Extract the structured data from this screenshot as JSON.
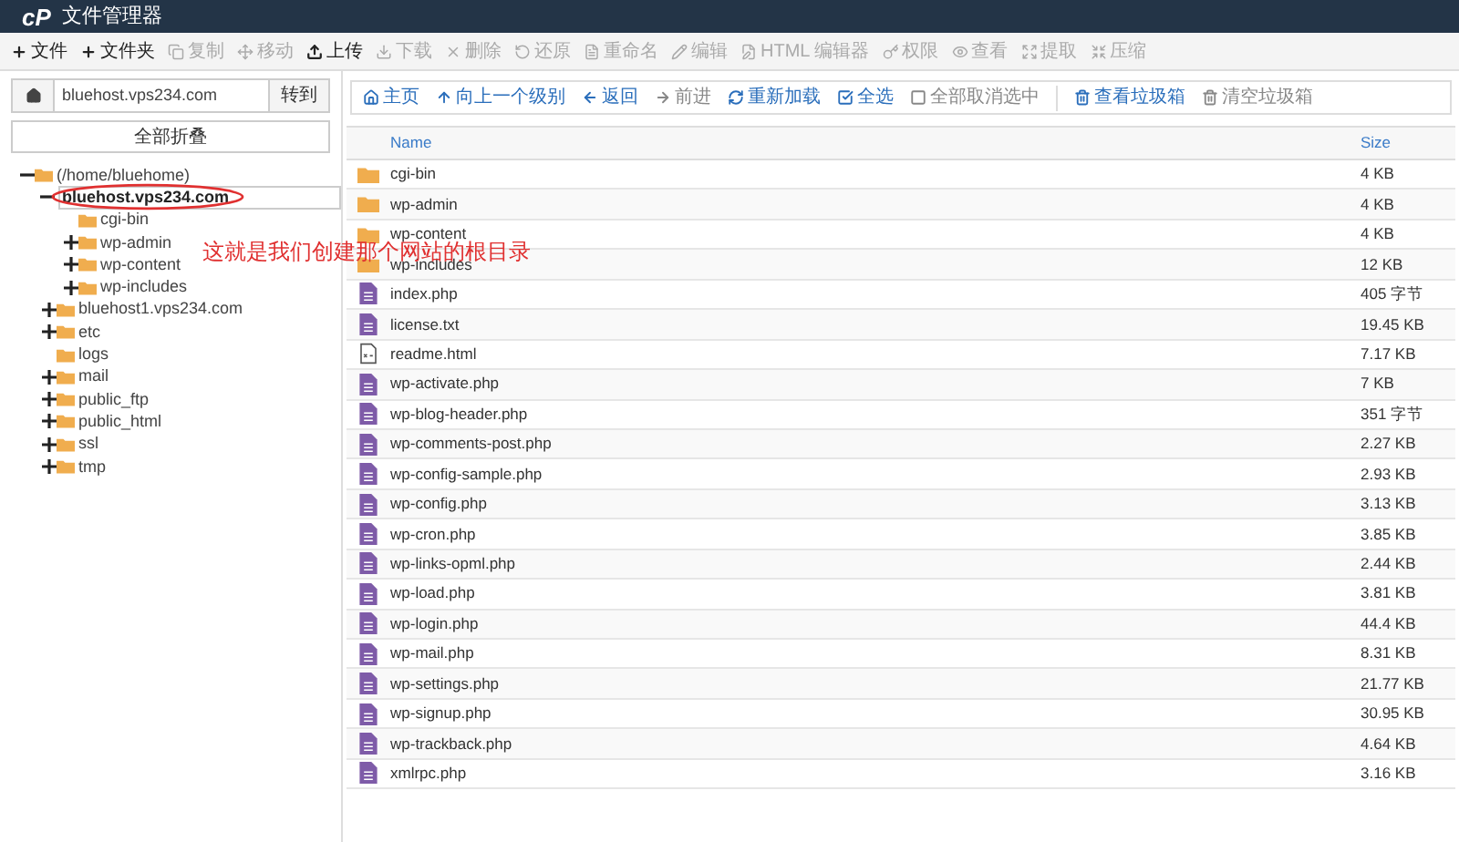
{
  "header": {
    "logo": "cP",
    "title": "文件管理器"
  },
  "toolbar": [
    {
      "label": "文件",
      "disabled": false
    },
    {
      "label": "文件夹",
      "disabled": false
    },
    {
      "label": "复制",
      "disabled": true
    },
    {
      "label": "移动",
      "disabled": true
    },
    {
      "label": "上传",
      "disabled": false
    },
    {
      "label": "下载",
      "disabled": true
    },
    {
      "label": "删除",
      "disabled": true
    },
    {
      "label": "还原",
      "disabled": true
    },
    {
      "label": "重命名",
      "disabled": true
    },
    {
      "label": "编辑",
      "disabled": true
    },
    {
      "label": "HTML 编辑器",
      "disabled": true
    },
    {
      "label": "权限",
      "disabled": true
    },
    {
      "label": "查看",
      "disabled": true
    },
    {
      "label": "提取",
      "disabled": true
    },
    {
      "label": "压缩",
      "disabled": true
    }
  ],
  "path_bar": {
    "value": "bluehost.vps234.com",
    "go": "转到"
  },
  "collapse_all": "全部折叠",
  "tree": [
    {
      "label": "(/home/bluehome)",
      "expanded": true,
      "selected": false,
      "children": [
        {
          "label": "bluehost.vps234.com",
          "expanded": true,
          "selected": true,
          "children": [
            {
              "label": "cgi-bin",
              "selected": false
            },
            {
              "label": "wp-admin",
              "expanded": false,
              "selected": false
            },
            {
              "label": "wp-content",
              "expanded": false,
              "selected": false
            },
            {
              "label": "wp-includes",
              "expanded": false,
              "selected": false
            }
          ]
        },
        {
          "label": "bluehost1.vps234.com",
          "expanded": false,
          "selected": false
        },
        {
          "label": "etc",
          "expanded": false,
          "selected": false
        },
        {
          "label": "logs",
          "selected": false
        },
        {
          "label": "mail",
          "expanded": false,
          "selected": false
        },
        {
          "label": "public_ftp",
          "expanded": false,
          "selected": false
        },
        {
          "label": "public_html",
          "expanded": false,
          "selected": false
        },
        {
          "label": "ssl",
          "expanded": false,
          "selected": false
        },
        {
          "label": "tmp",
          "expanded": false,
          "selected": false
        }
      ]
    }
  ],
  "annotation": "这就是我们创建那个网站的根目录",
  "nav": [
    {
      "label": "主页",
      "disabled": false
    },
    {
      "label": "向上一个级别",
      "disabled": false
    },
    {
      "label": "返回",
      "disabled": false
    },
    {
      "label": "前进",
      "disabled": true
    },
    {
      "label": "重新加载",
      "disabled": false
    },
    {
      "label": "全选",
      "disabled": false
    },
    {
      "label": "全部取消选中",
      "disabled": true
    },
    {
      "label": "查看垃圾箱",
      "disabled": false
    },
    {
      "label": "清空垃圾箱",
      "disabled": true
    }
  ],
  "table": {
    "columns": [
      "Name",
      "Size"
    ],
    "rows": [
      {
        "kind": "folder",
        "name": "cgi-bin",
        "size": "4 KB"
      },
      {
        "kind": "folder",
        "name": "wp-admin",
        "size": "4 KB"
      },
      {
        "kind": "folder",
        "name": "wp-content",
        "size": "4 KB"
      },
      {
        "kind": "folder",
        "name": "wp-includes",
        "size": "12 KB"
      },
      {
        "kind": "file",
        "name": "index.php",
        "size": "405 字节"
      },
      {
        "kind": "file",
        "name": "license.txt",
        "size": "19.45 KB"
      },
      {
        "kind": "html",
        "name": "readme.html",
        "size": "7.17 KB"
      },
      {
        "kind": "file",
        "name": "wp-activate.php",
        "size": "7 KB"
      },
      {
        "kind": "file",
        "name": "wp-blog-header.php",
        "size": "351 字节"
      },
      {
        "kind": "file",
        "name": "wp-comments-post.php",
        "size": "2.27 KB"
      },
      {
        "kind": "file",
        "name": "wp-config-sample.php",
        "size": "2.93 KB"
      },
      {
        "kind": "file",
        "name": "wp-config.php",
        "size": "3.13 KB"
      },
      {
        "kind": "file",
        "name": "wp-cron.php",
        "size": "3.85 KB"
      },
      {
        "kind": "file",
        "name": "wp-links-opml.php",
        "size": "2.44 KB"
      },
      {
        "kind": "file",
        "name": "wp-load.php",
        "size": "3.81 KB"
      },
      {
        "kind": "file",
        "name": "wp-login.php",
        "size": "44.4 KB"
      },
      {
        "kind": "file",
        "name": "wp-mail.php",
        "size": "8.31 KB"
      },
      {
        "kind": "file",
        "name": "wp-settings.php",
        "size": "21.77 KB"
      },
      {
        "kind": "file",
        "name": "wp-signup.php",
        "size": "30.95 KB"
      },
      {
        "kind": "file",
        "name": "wp-trackback.php",
        "size": "4.64 KB"
      },
      {
        "kind": "file",
        "name": "xmlrpc.php",
        "size": "3.16 KB"
      }
    ]
  }
}
